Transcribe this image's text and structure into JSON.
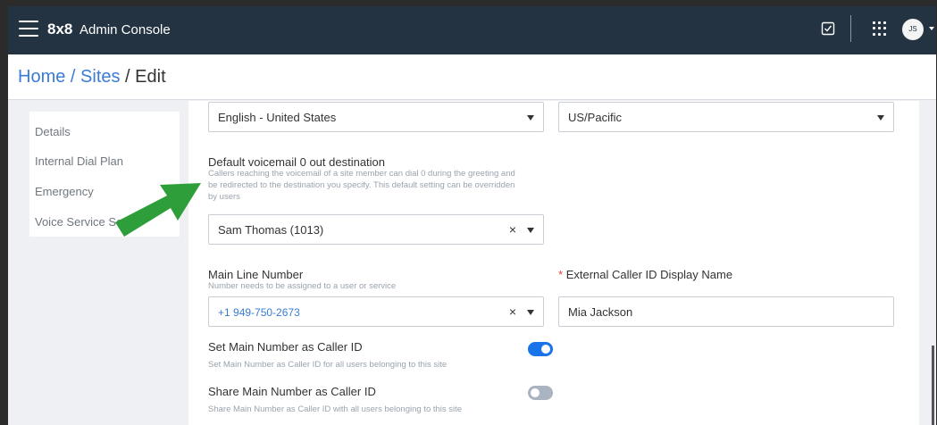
{
  "header": {
    "brand": "8x8",
    "app_name": "Admin Console",
    "avatar_initials": "JS",
    "icons": [
      "hamburger-menu-icon",
      "tasks-checkbox-icon",
      "apps-grid-icon",
      "chevron-down-icon"
    ]
  },
  "breadcrumb": {
    "home": "Home",
    "sep1": " / ",
    "sites": "Sites",
    "sep2": " / ",
    "current": "Edit"
  },
  "sidebar": {
    "items": [
      {
        "label": "Details"
      },
      {
        "label": "Internal Dial Plan"
      },
      {
        "label": "Emergency"
      },
      {
        "label": "Voice Service Se"
      }
    ]
  },
  "form": {
    "language": {
      "value": "English - United States"
    },
    "timezone": {
      "value": "US/Pacific"
    },
    "voicemail": {
      "label": "Default voicemail 0 out destination",
      "hint_line1": "Callers reaching the voicemail of a site member can dial 0 during the greeting and",
      "hint_line2": "be redirected to the destination you specify. This default setting can be overridden",
      "hint_line3": "by users",
      "value": "Sam Thomas (1013)",
      "clear": "×"
    },
    "main_line": {
      "label": "Main Line Number",
      "hint": "Number needs to be assigned to a user or service",
      "value": "+1 949-750-2673",
      "clear": "×"
    },
    "caller_id_name": {
      "required_mark": "*",
      "label": "External Caller ID Display Name",
      "value": "Mia Jackson"
    },
    "set_main_caller_id": {
      "label": "Set Main Number as Caller ID",
      "hint": "Set Main Number as Caller ID for all users belonging to this site",
      "enabled": true
    },
    "share_main_caller_id": {
      "label": "Share Main Number as Caller ID",
      "hint": "Share Main Number as Caller ID with all users belonging to this site",
      "enabled": false
    }
  },
  "colors": {
    "header_bg": "#233342",
    "link_blue": "#3a7bd5",
    "toggle_on": "#1a73e8",
    "toggle_off": "#aab4c0",
    "annotation_arrow": "#2e9e3a"
  }
}
